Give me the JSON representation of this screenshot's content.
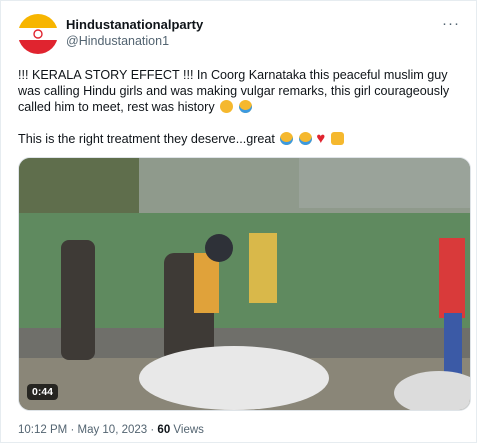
{
  "account": {
    "name": "Hindustanationalparty",
    "handle": "@Hindustanation1"
  },
  "tweet": {
    "line1": "!!! KERALA STORY EFFECT !!! In Coorg Karnataka this peaceful muslim guy was calling Hindu girls and was making vulgar remarks, this girl courageously called him to meet, rest was history",
    "line2": "This is the right treatment they deserve...great"
  },
  "video": {
    "duration": "0:44"
  },
  "meta": {
    "time": "10:12 PM",
    "date": "May 10, 2023",
    "separator": "·",
    "views_count": "60",
    "views_label": "Views"
  },
  "icons": {
    "more": "more-options-icon",
    "emojis_line1": [
      "face-hand-over-mouth-emoji",
      "tears-of-joy-emoji"
    ],
    "emojis_line2": [
      "tears-of-joy-emoji",
      "tears-of-joy-emoji",
      "red-heart-emoji",
      "thumbs-up-emoji"
    ]
  },
  "colors": {
    "text": "#0f1419",
    "secondary": "#536471",
    "avatar_saffron": "#f7b500",
    "avatar_red": "#e0242f"
  }
}
